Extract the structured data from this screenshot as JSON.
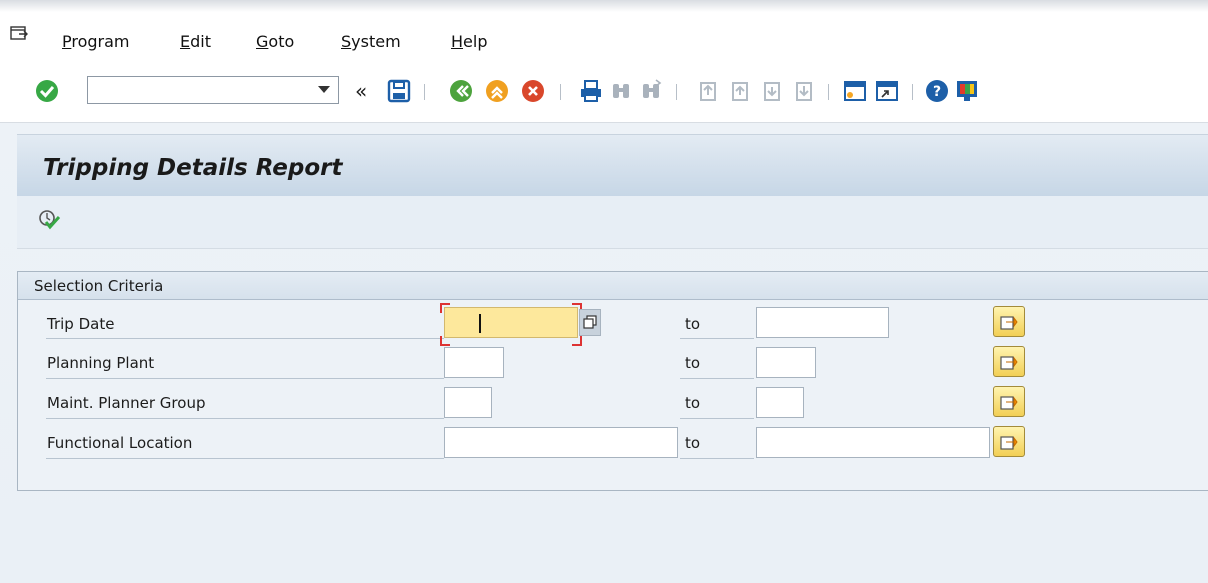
{
  "menu": [
    {
      "accel": "P",
      "rest": "rogram"
    },
    {
      "accel": "E",
      "rest": "dit"
    },
    {
      "accel": "G",
      "rest": "oto"
    },
    {
      "accel": "S",
      "rest": "ystem"
    },
    {
      "accel": "H",
      "rest": "elp"
    }
  ],
  "toolbar": {
    "command_field_value": "",
    "icons": [
      "enter-check-icon",
      "command-dropdown-icon",
      "collapse-icon",
      "save-icon",
      "back-icon",
      "exit-icon",
      "cancel-icon",
      "print-icon",
      "find-icon",
      "find-next-icon",
      "first-page-icon",
      "previous-page-icon",
      "next-page-icon",
      "last-page-icon",
      "new-session-icon",
      "shortcut-icon",
      "help-icon",
      "customize-layout-icon"
    ]
  },
  "page": {
    "title": "Tripping Details Report"
  },
  "selection": {
    "group_title": "Selection Criteria",
    "rows": [
      {
        "label": "Trip Date",
        "from": "",
        "to_label": "to",
        "to": ""
      },
      {
        "label": "Planning Plant",
        "from": "",
        "to_label": "to",
        "to": ""
      },
      {
        "label": "Maint. Planner Group",
        "from": "",
        "to_label": "to",
        "to": ""
      },
      {
        "label": "Functional Location",
        "from": "",
        "to_label": "to",
        "to": ""
      }
    ]
  },
  "colors": {
    "accent_green": "#2e9e3f",
    "focus_field": "#fde89c",
    "title_bar": "#c6d6e6"
  }
}
